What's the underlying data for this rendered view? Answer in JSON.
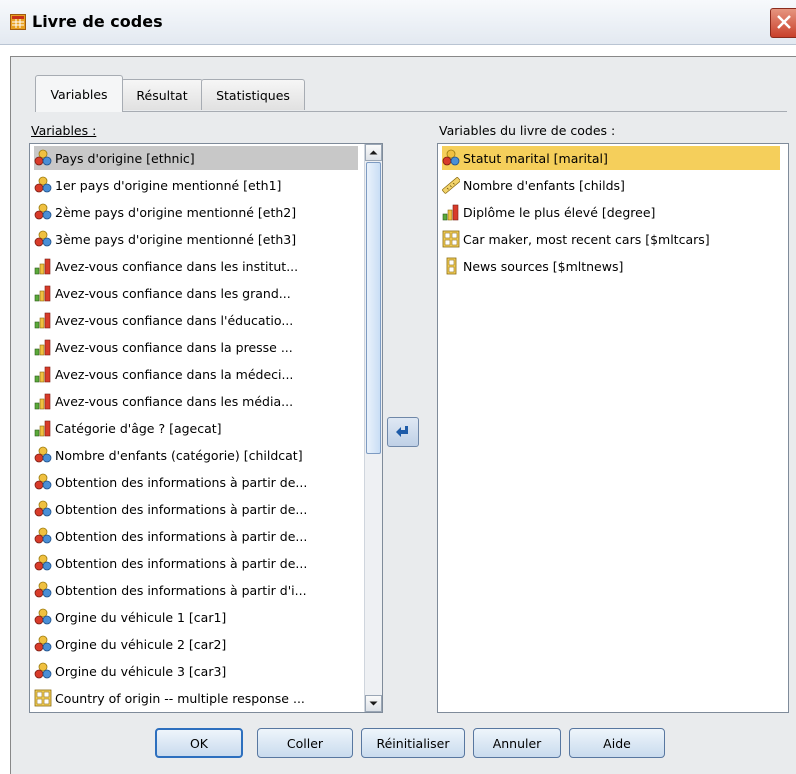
{
  "window": {
    "title": "Livre de codes"
  },
  "tabs": [
    {
      "label": "Variables"
    },
    {
      "label": "Résultat"
    },
    {
      "label": "Statistiques"
    }
  ],
  "source": {
    "label": "Variables :",
    "items": [
      {
        "icon": "nominal-icon",
        "label": "Pays d'origine [ethnic]"
      },
      {
        "icon": "nominal-icon",
        "label": "1er pays d'origine mentionné [eth1]"
      },
      {
        "icon": "nominal-icon",
        "label": "2ème pays d'origine mentionné [eth2]"
      },
      {
        "icon": "nominal-icon",
        "label": "3ème pays d'origine mentionné [eth3]"
      },
      {
        "icon": "ordinal-icon",
        "label": "Avez-vous confiance dans les institut..."
      },
      {
        "icon": "ordinal-icon",
        "label": "Avez-vous confiance dans les grand..."
      },
      {
        "icon": "ordinal-icon",
        "label": "Avez-vous confiance dans l'éducatio..."
      },
      {
        "icon": "ordinal-icon",
        "label": "Avez-vous confiance dans la presse ..."
      },
      {
        "icon": "ordinal-icon",
        "label": "Avez-vous confiance dans la médeci..."
      },
      {
        "icon": "ordinal-icon",
        "label": "Avez-vous confiance dans les média..."
      },
      {
        "icon": "ordinal-icon",
        "label": "Catégorie d'âge ? [agecat]"
      },
      {
        "icon": "nominal-icon",
        "label": "Nombre d'enfants (catégorie) [childcat]"
      },
      {
        "icon": "nominal-icon",
        "label": "Obtention des informations à partir de..."
      },
      {
        "icon": "nominal-icon",
        "label": "Obtention des informations à partir de..."
      },
      {
        "icon": "nominal-icon",
        "label": "Obtention des informations à partir de..."
      },
      {
        "icon": "nominal-icon",
        "label": "Obtention des informations à partir de..."
      },
      {
        "icon": "nominal-icon",
        "label": "Obtention des informations à partir d'i..."
      },
      {
        "icon": "nominal-icon",
        "label": "Orgine du véhicule 1 [car1]"
      },
      {
        "icon": "nominal-icon",
        "label": "Orgine du véhicule 2 [car2]"
      },
      {
        "icon": "nominal-icon",
        "label": "Orgine du véhicule 3 [car3]"
      },
      {
        "icon": "multiple-category-set-icon",
        "label": "Country of origin -- multiple response ..."
      }
    ]
  },
  "target": {
    "label": "Variables du livre de codes :",
    "items": [
      {
        "icon": "nominal-icon",
        "label": "Statut marital [marital]"
      },
      {
        "icon": "scale-icon",
        "label": "Nombre d'enfants [childs]"
      },
      {
        "icon": "ordinal-icon",
        "label": "Diplôme le plus élevé [degree]"
      },
      {
        "icon": "multiple-category-set-icon",
        "label": "Car maker, most recent cars [$mltcars]"
      },
      {
        "icon": "multiple-dichotomy-set-icon",
        "label": "News sources [$mltnews]"
      }
    ]
  },
  "buttons": {
    "ok": "OK",
    "paste": "Coller",
    "reset": "Réinitialiser",
    "cancel": "Annuler",
    "help": "Aide"
  },
  "colors": {
    "selection_source": "#c8c8c8",
    "selection_target": "#f5cf5b",
    "accent": "#2d6fbe"
  }
}
